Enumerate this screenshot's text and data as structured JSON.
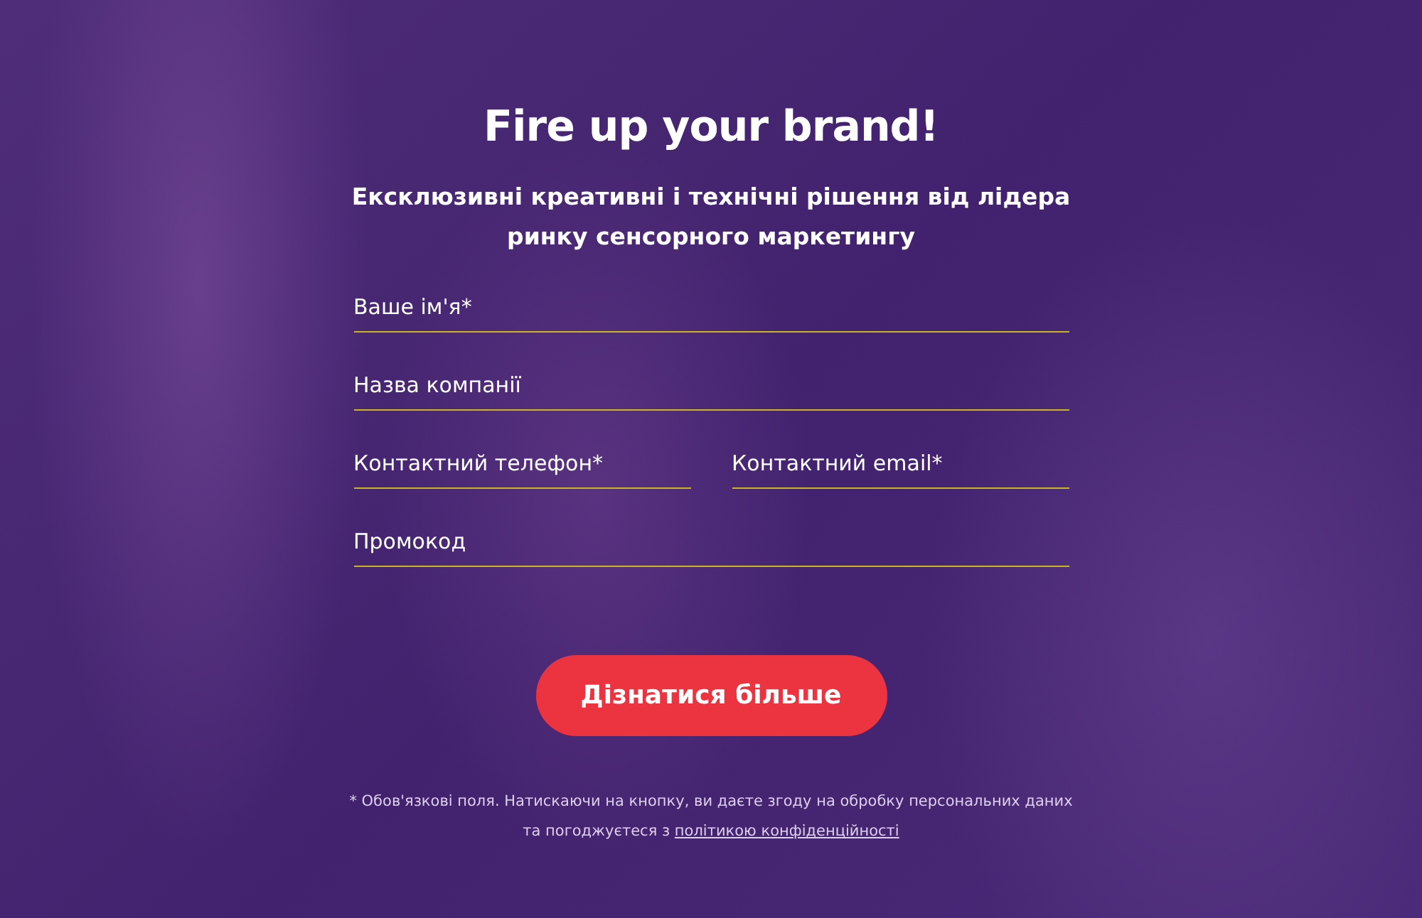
{
  "title": "Fire up your brand!",
  "subtitle": "Ексклюзивні креативні і технічні рішення від лідера ринку сенсорного маркетингу",
  "form": {
    "rows": [
      [
        {
          "placeholder": "Ваше ім'я*"
        }
      ],
      [
        {
          "placeholder": "Назва компанії"
        }
      ],
      [
        {
          "placeholder": "Контактний телефон*"
        },
        {
          "placeholder": "Контактний email*"
        }
      ],
      [
        {
          "placeholder": "Промокод"
        }
      ]
    ],
    "submit": "Дізнатися більше"
  },
  "note": {
    "text": "* Обов'язкові поля. Натискаючи на кнопку, ви даєте згоду на обробку персональних даних та погоджуєтеся з",
    "link": "політикою конфіденційності"
  }
}
